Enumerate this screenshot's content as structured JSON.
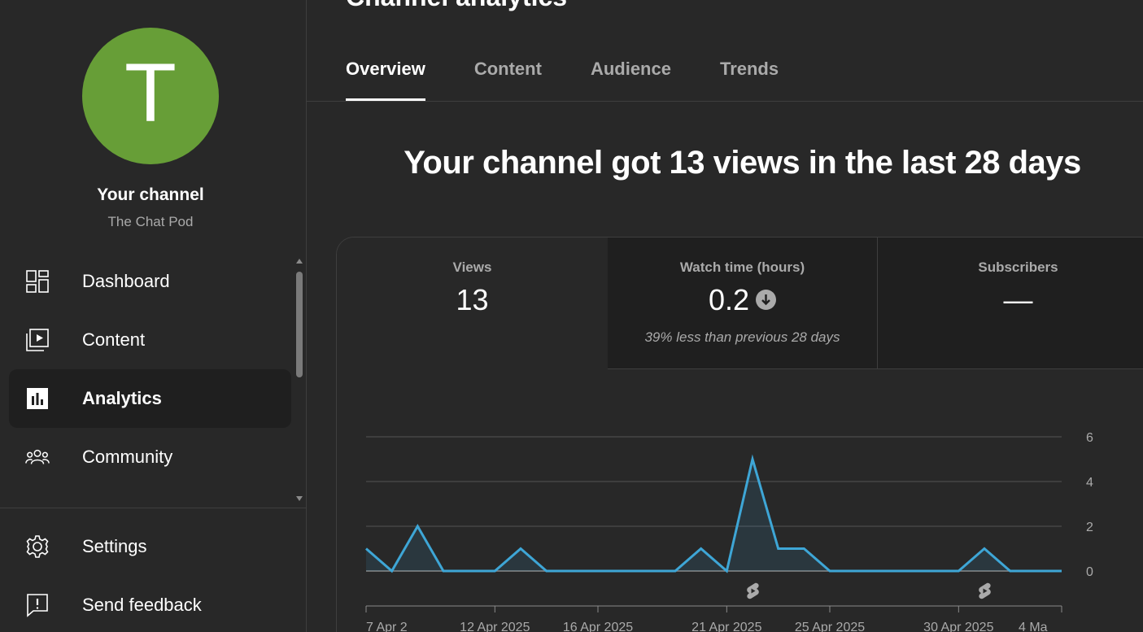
{
  "sidebar": {
    "avatar_letter": "T",
    "channel_title": "Your channel",
    "channel_name": "The Chat Pod",
    "nav": [
      {
        "label": "Dashboard",
        "icon": "dashboard-icon"
      },
      {
        "label": "Content",
        "icon": "content-icon"
      },
      {
        "label": "Analytics",
        "icon": "analytics-icon",
        "active": true
      },
      {
        "label": "Community",
        "icon": "community-icon"
      }
    ],
    "bottom": [
      {
        "label": "Settings",
        "icon": "gear-icon"
      },
      {
        "label": "Send feedback",
        "icon": "feedback-icon"
      }
    ]
  },
  "page": {
    "title": "Channel analytics",
    "tabs": [
      "Overview",
      "Content",
      "Audience",
      "Trends"
    ],
    "active_tab": "Overview",
    "headline": "Your channel got 13 views in the last 28 days"
  },
  "metrics": [
    {
      "label": "Views",
      "value": "13",
      "note": ""
    },
    {
      "label": "Watch time (hours)",
      "value": "0.2",
      "note": "39% less than previous 28 days",
      "trend": "down"
    },
    {
      "label": "Subscribers",
      "value": "—",
      "note": ""
    }
  ],
  "colors": {
    "avatar": "#679e37",
    "line": "#3ea6d6",
    "background": "#282828"
  },
  "chart_data": {
    "type": "line",
    "x_tick_labels": [
      "7 Apr 2",
      "12 Apr 2025",
      "16 Apr 2025",
      "21 Apr 2025",
      "25 Apr 2025",
      "30 Apr 2025",
      "4 Ma"
    ],
    "y_ticks": [
      0,
      2,
      4,
      6
    ],
    "ylim": [
      0,
      6
    ],
    "grid": true,
    "values": [
      1,
      0,
      2,
      0,
      0,
      0,
      1,
      0,
      0,
      0,
      0,
      0,
      0,
      1,
      0,
      5,
      1,
      1,
      0,
      0,
      0,
      0,
      0,
      0,
      1,
      0,
      0,
      0
    ],
    "shorts_markers_at_index": [
      15,
      24
    ]
  }
}
